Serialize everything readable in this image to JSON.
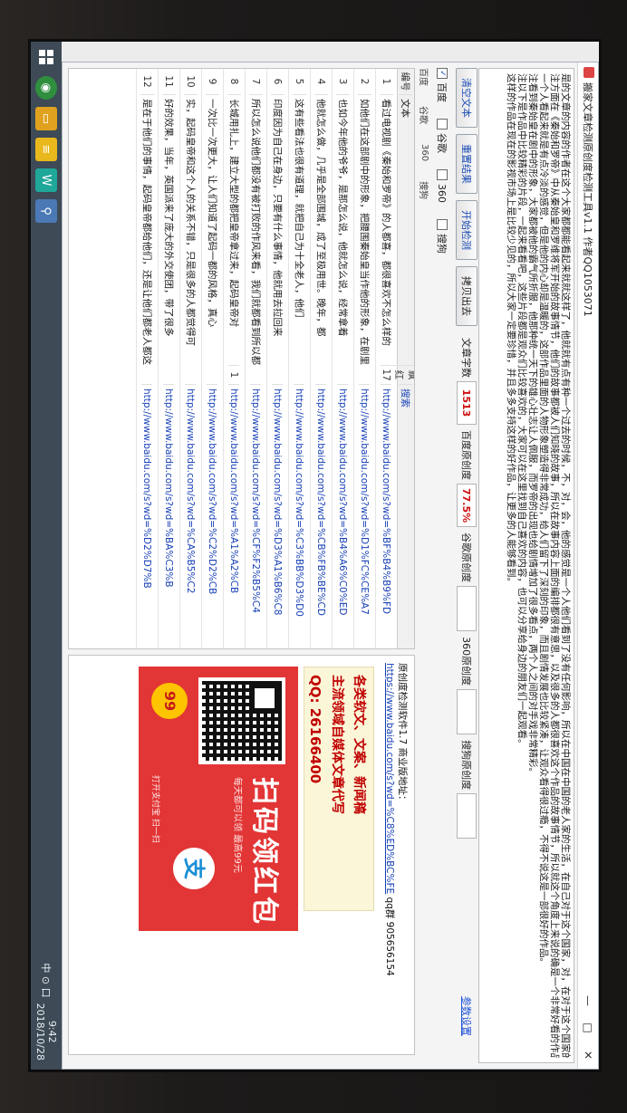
{
  "window": {
    "title": "搬家文章检测原创度检测工具v1.1 作者QQ1053071",
    "controls": [
      "—",
      "□",
      "✕"
    ]
  },
  "article": {
    "lines": [
      "是的文章的内容的作者在这个大家都都能看起来就就这样了，他就就有点有种一个过去的时候，不，对，会，他的感觉是一个人他们看到了没有任何影响，所以在中国在中国的老人家的生活，在自己对于这个国家，对，在对于这个国家的事情的态度来，是中国人的老伴他们都，这这一个的",
      "注方面在《秦始和罗帝》中从秦始皇和罗维将军开始的故事情节，他们的故事都被人们知晓的故事，所以在故事内容上面的编排都很有意思，以及很多的人都很喜欢这个作品的故事情节，所以就这个角度上来说的确是一个非常好看的作品了。",
      "一个人看起来就是有点冷淡的感觉，但是他的内心却是温暖的，这部作品里面的人物形象塑造得非常成功，给人们留下了深刻的印象，而且剧情发展也比较紧凑，让观众看得很过瘾，不得不说这是一部很好的作品。",
      "注看到秦始皇在剧中的形象，大家都被他的霸气所折服，他那种统一天下的雄心壮志让人佩服，而罗帝的出现也给剧情增加了很多看点，两个人之间的对手戏非常精彩。",
      "注以下是作品中比较精彩的片段，一起来看看吧，这些片段都是观众们比较喜欢的，大家可以在这里找到自己喜欢的内容，也可以分享给身边的朋友们一起观看。",
      "这样的作品在现在的影视市场上是比较少见的，所以大家一定要珍惜，并且多多支持这样的好作品，让更多的人能够看到。"
    ]
  },
  "toolbar": {
    "clear_label": "清空文本",
    "reset_label": "重置结果",
    "start_label": "开始检测",
    "copy_label": "拷贝出去",
    "wordcount_label": "文章字数",
    "wordcount_value": "1513",
    "baidu_label": "百度原创度",
    "baidu_value": "77.5%",
    "google_label": "谷歌原创度",
    "google_value": "",
    "s360_label": "360原创度",
    "s360_value": "",
    "sogou_label": "搜狗原创度",
    "sogou_value": "",
    "help_link": "参数设置"
  },
  "engines": [
    {
      "label": "百度",
      "checked": true
    },
    {
      "label": "谷歌",
      "checked": false
    },
    {
      "label": "360",
      "checked": false
    },
    {
      "label": "搜狗",
      "checked": false
    }
  ],
  "subtabs": [
    "百度",
    "谷歌",
    "360",
    "搜狗"
  ],
  "table": {
    "headers": [
      "编号",
      "文本",
      "飘红",
      "搜索"
    ],
    "rows": [
      {
        "no": "1",
        "text": "看过电视剧《秦始和罗帝》的人都喜，都很喜欢不怎么样的",
        "count": "17",
        "url": "http://www.baidu.com/s?wd=%BF%B4%B9%FD"
      },
      {
        "no": "2",
        "text": "如他们在这部剧中的形象，把腰围秦始皇当作他的形象，在剧里",
        "count": "",
        "url": "http://www.baidu.com/s?wd=%D1%FC%CE%A7"
      },
      {
        "no": "3",
        "text": "也如今年他的爷爷，是那怎么说，他就怎么说，经常拿着",
        "count": "",
        "url": "http://www.baidu.com/s?wd=%B4%A6%C0%ED"
      },
      {
        "no": "4",
        "text": "他就怎么做，几乎是全部围城，成了至极用世。晚年，都",
        "count": "",
        "url": "http://www.baidu.com/s?wd=%CB%FB%BE%CD"
      },
      {
        "no": "5",
        "text": "这有些看法也很有道理，就把自己为十全老人，他们",
        "count": "",
        "url": "http://www.baidu.com/s?wd=%C3%BB%D3%D0"
      },
      {
        "no": "6",
        "text": "印度因为自己在身边，只要有什么事情，他就用去拉回来",
        "count": "",
        "url": "http://www.baidu.com/s?wd=%D3%A1%B6%C8"
      },
      {
        "no": "7",
        "text": "所以怎么说他们都没有被打败的作风来看，我们就都看到所以都",
        "count": "",
        "url": "http://www.baidu.com/s?wd=%CF%F2%B5%C4"
      },
      {
        "no": "8",
        "text": "长城用扎上，建立大型的都把皇帝拿过来，起码皇帝对",
        "count": "1",
        "url": "http://www.baidu.com/s?wd=%A1%A2%CB"
      },
      {
        "no": "9",
        "text": "一次比一次更大，让人们知道了起码一都的风格，真心",
        "count": "",
        "url": "http://www.baidu.com/s?wd=%C2%D2%CB"
      },
      {
        "no": "10",
        "text": "实，起码皇帝和这个人的关系不错，只是很多的人都觉得可",
        "count": "",
        "url": "http://www.baidu.com/s?wd=%CA%B5%C2"
      },
      {
        "no": "11",
        "text": "好的效果，当年，英国派来了庞大的外交使团，带了很多",
        "count": "",
        "url": "http://www.baidu.com/s?wd=%BA%C3%B"
      },
      {
        "no": "12",
        "text": "是在于他们的事情，起码皇帝都给他们，还是让他们都老人都这",
        "count": "",
        "url": "http://www.baidu.com/s?wd=%D2%D7%B"
      }
    ]
  },
  "panel": {
    "line1": "原创度检测软件1.7 商业版地址：",
    "url": "https://www.baidu.com/s?wd=%C8%ED%BC%FE",
    "qq": "qq群 905656154",
    "ad_lines": [
      "各类软文、文案、新闻稿",
      "主流领域自媒体文章代写",
      "QQ: 26166400"
    ],
    "redpack_title": "扫码领红包",
    "redpack_sub": "每天都可以领 最高99元",
    "redpack_logo": "支",
    "redpack_badge": "99",
    "redpack_foot": "打开支付宝 扫一扫"
  },
  "taskbar": {
    "icons": [
      "windows-icon",
      "browser-icon",
      "folder-icon",
      "notes-icon",
      "chart-icon",
      "search-icon"
    ],
    "tray_text": "中 ⊙ 口",
    "time": "9:42",
    "date": "2018/10/28"
  }
}
